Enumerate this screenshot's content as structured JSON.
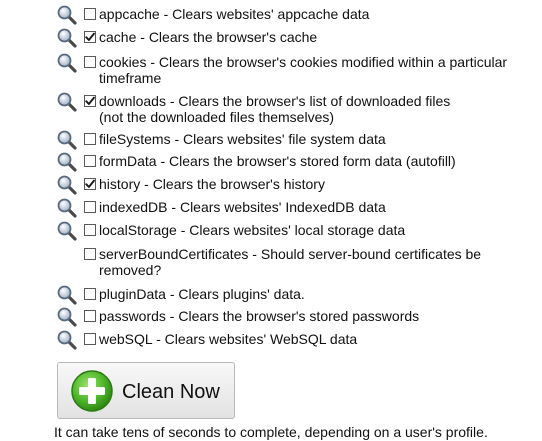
{
  "options": [
    {
      "id": "appcache",
      "name": "appcache",
      "desc": "Clears websites' appcache data",
      "checked": false,
      "has_magnifier": true
    },
    {
      "id": "cache",
      "name": "cache",
      "desc": "Clears the browser's cache",
      "checked": true,
      "has_magnifier": true
    },
    {
      "id": "cookies",
      "name": "cookies",
      "desc": "Clears the browser's cookies modified within a particular\ntimeframe",
      "checked": false,
      "has_magnifier": true
    },
    {
      "id": "downloads",
      "name": "downloads",
      "desc": "Clears the browser's list of downloaded files\n(not the downloaded files themselves)",
      "checked": true,
      "has_magnifier": true
    },
    {
      "id": "fileSystems",
      "name": "fileSystems",
      "desc": "Clears websites' file system data",
      "checked": false,
      "has_magnifier": true
    },
    {
      "id": "formData",
      "name": "formData",
      "desc": "Clears the browser's stored form data (autofill)",
      "checked": false,
      "has_magnifier": true
    },
    {
      "id": "history",
      "name": "history",
      "desc": "Clears the browser's history",
      "checked": true,
      "has_magnifier": true
    },
    {
      "id": "indexedDB",
      "name": "indexedDB",
      "desc": "Clears websites' IndexedDB data",
      "checked": false,
      "has_magnifier": true
    },
    {
      "id": "localStorage",
      "name": "localStorage",
      "desc": "Clears websites' local storage data",
      "checked": false,
      "has_magnifier": true
    },
    {
      "id": "serverBoundCertificates",
      "name": "serverBoundCertificates",
      "desc": "Should server-bound certificates be\nremoved?",
      "checked": false,
      "has_magnifier": false
    },
    {
      "id": "pluginData",
      "name": "pluginData",
      "desc": "Clears plugins' data.",
      "checked": false,
      "has_magnifier": true
    },
    {
      "id": "passwords",
      "name": "passwords",
      "desc": "Clears the browser's stored passwords",
      "checked": false,
      "has_magnifier": true
    },
    {
      "id": "webSQL",
      "name": "webSQL",
      "desc": "Clears websites' WebSQL data",
      "checked": false,
      "has_magnifier": true
    }
  ],
  "clean_button": {
    "label": "Clean Now",
    "icon": "green-plus-icon",
    "accent_color": "#3a9a1f"
  },
  "footer": {
    "note": "It can take tens of seconds to complete, depending on a user's profile."
  },
  "icons": {
    "details": "magnifier-icon",
    "checkmark": "check-icon"
  }
}
